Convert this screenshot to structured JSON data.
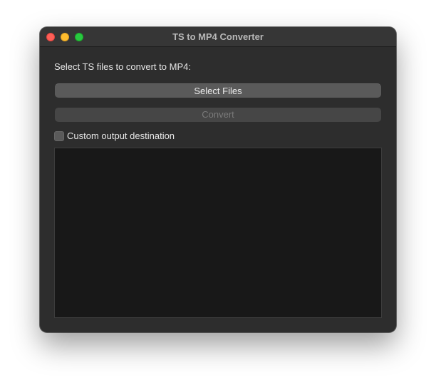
{
  "window": {
    "title": "TS to MP4 Converter"
  },
  "main": {
    "prompt": "Select TS files to convert to MP4:",
    "select_button_label": "Select Files",
    "convert_button_label": "Convert",
    "custom_output_label": "Custom output destination",
    "custom_output_checked": false,
    "log_text": ""
  },
  "colors": {
    "window_bg": "#2d2d2d",
    "log_bg": "#181818",
    "close": "#fe5f57",
    "minimize": "#febc2e",
    "maximize": "#28c840"
  },
  "icons": {
    "close": "close-traffic-light",
    "minimize": "minimize-traffic-light",
    "maximize": "maximize-traffic-light"
  }
}
